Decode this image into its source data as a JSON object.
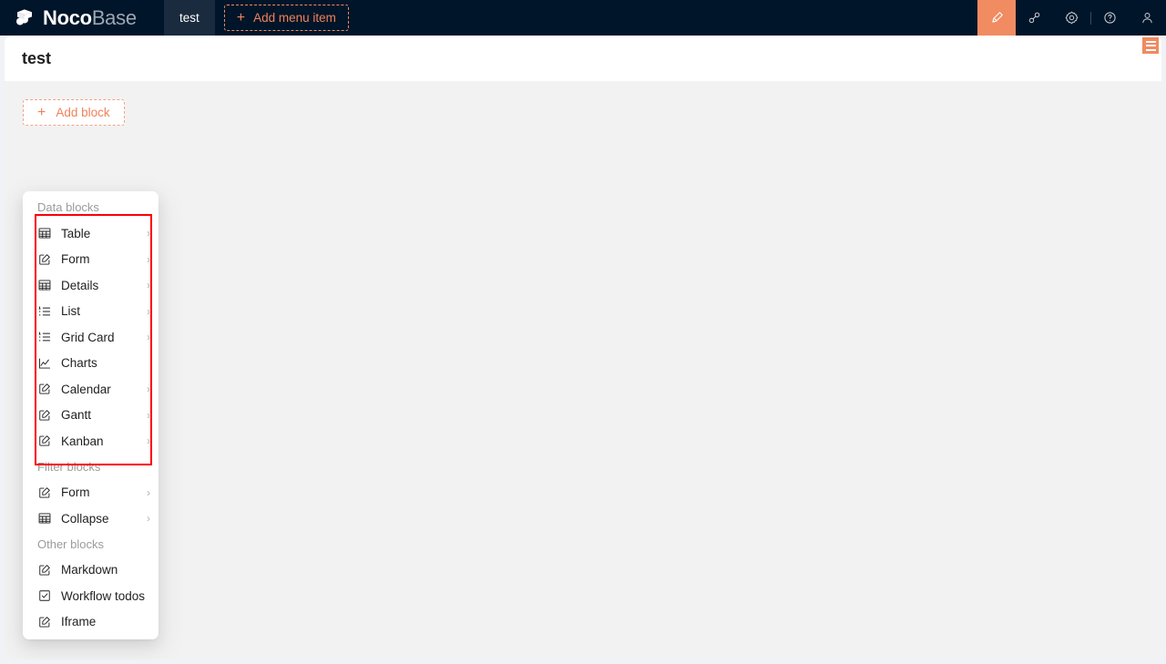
{
  "header": {
    "logo_text_primary": "Noco",
    "logo_text_secondary": "Base",
    "logo_icon": "nocobase-cube-logo",
    "tabs": [
      {
        "label": "test",
        "name": "menu-tab-test"
      }
    ],
    "add_menu_item_label": "Add menu item",
    "add_menu_item_plus": "+",
    "right_icons": [
      {
        "name": "ui-editor-pen-icon",
        "label": "UI editor",
        "active": true,
        "accent": "#f18b62"
      },
      {
        "name": "plugin-settings-icon",
        "label": "Plugin settings",
        "active": false
      },
      {
        "name": "gear-icon",
        "label": "Settings",
        "active": false
      },
      {
        "name": "help-circle-icon",
        "label": "Help",
        "active": false
      },
      {
        "name": "user-avatar-icon",
        "label": "User",
        "active": false
      }
    ]
  },
  "page": {
    "title": "test",
    "designer_toggle_name": "page-designer-toggle"
  },
  "toolbar": {
    "add_block_label": "Add block",
    "add_block_plus": "+"
  },
  "block_menu": {
    "highlight_color": "#fb0007",
    "chevron_glyph": "›",
    "groups": [
      {
        "title": "Data blocks",
        "items": [
          {
            "label": "Table",
            "icon": "table-icon",
            "has_submenu": true
          },
          {
            "label": "Form",
            "icon": "form-icon",
            "has_submenu": true
          },
          {
            "label": "Details",
            "icon": "table-icon",
            "has_submenu": true
          },
          {
            "label": "List",
            "icon": "list-icon",
            "has_submenu": true
          },
          {
            "label": "Grid Card",
            "icon": "list-icon",
            "has_submenu": true
          },
          {
            "label": "Charts",
            "icon": "line-chart-icon",
            "has_submenu": false
          },
          {
            "label": "Calendar",
            "icon": "form-icon",
            "has_submenu": true
          },
          {
            "label": "Gantt",
            "icon": "form-icon",
            "has_submenu": true
          },
          {
            "label": "Kanban",
            "icon": "form-icon",
            "has_submenu": true
          }
        ]
      },
      {
        "title": "Filter blocks",
        "items": [
          {
            "label": "Form",
            "icon": "form-icon",
            "has_submenu": true
          },
          {
            "label": "Collapse",
            "icon": "table-icon",
            "has_submenu": true
          }
        ]
      },
      {
        "title": "Other blocks",
        "items": [
          {
            "label": "Markdown",
            "icon": "form-icon",
            "has_submenu": false
          },
          {
            "label": "Workflow todos",
            "icon": "checkbox-icon",
            "has_submenu": false
          },
          {
            "label": "Iframe",
            "icon": "form-icon",
            "has_submenu": false
          }
        ]
      }
    ]
  },
  "colors": {
    "header_bg": "#001529",
    "accent": "#f0825a",
    "page_body_bg": "#f2f2f2"
  }
}
